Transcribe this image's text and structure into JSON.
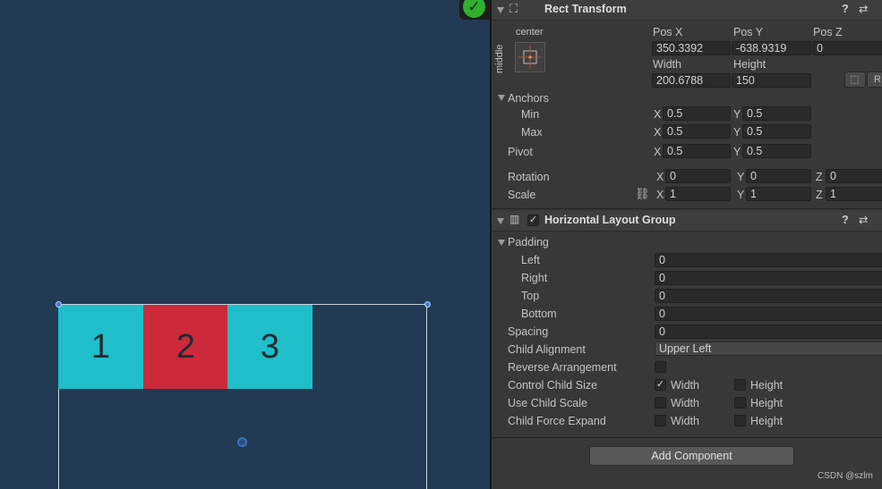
{
  "scene": {
    "cells": [
      {
        "label": "1",
        "color": "#20bec9"
      },
      {
        "label": "2",
        "color": "#cb2a3a"
      },
      {
        "label": "3",
        "color": "#20bec9"
      }
    ],
    "status_icon": "checkmark-circle-icon"
  },
  "rect_transform": {
    "title": "Rect Transform",
    "anchor_preset_top": "center",
    "anchor_preset_side": "middle",
    "pos_x_label": "Pos X",
    "pos_x": "350.3392",
    "pos_y_label": "Pos Y",
    "pos_y": "-638.9319",
    "pos_z_label": "Pos Z",
    "pos_z": "0",
    "width_label": "Width",
    "width": "200.6788",
    "height_label": "Height",
    "height": "150",
    "r_button": "R",
    "anchors_label": "Anchors",
    "min_label": "Min",
    "min_x": "0.5",
    "min_y": "0.5",
    "max_label": "Max",
    "max_x": "0.5",
    "max_y": "0.5",
    "pivot_label": "Pivot",
    "pivot_x": "0.5",
    "pivot_y": "0.5",
    "rotation_label": "Rotation",
    "rot_x": "0",
    "rot_y": "0",
    "rot_z": "0",
    "scale_label": "Scale",
    "scale_x": "1",
    "scale_y": "1",
    "scale_z": "1",
    "axis_x": "X",
    "axis_y": "Y",
    "axis_z": "Z"
  },
  "layout_group": {
    "title": "Horizontal Layout Group",
    "enabled": true,
    "padding_label": "Padding",
    "left_label": "Left",
    "left": "0",
    "right_label": "Right",
    "right": "0",
    "top_label": "Top",
    "top": "0",
    "bottom_label": "Bottom",
    "bottom": "0",
    "spacing_label": "Spacing",
    "spacing": "0",
    "child_alignment_label": "Child Alignment",
    "child_alignment": "Upper Left",
    "reverse_label": "Reverse Arrangement",
    "control_size_label": "Control Child Size",
    "use_scale_label": "Use Child Scale",
    "force_expand_label": "Child Force Expand",
    "width_opt": "Width",
    "height_opt": "Height",
    "control_width_checked": true
  },
  "add_component": "Add Component",
  "watermark": "CSDN @szlm"
}
